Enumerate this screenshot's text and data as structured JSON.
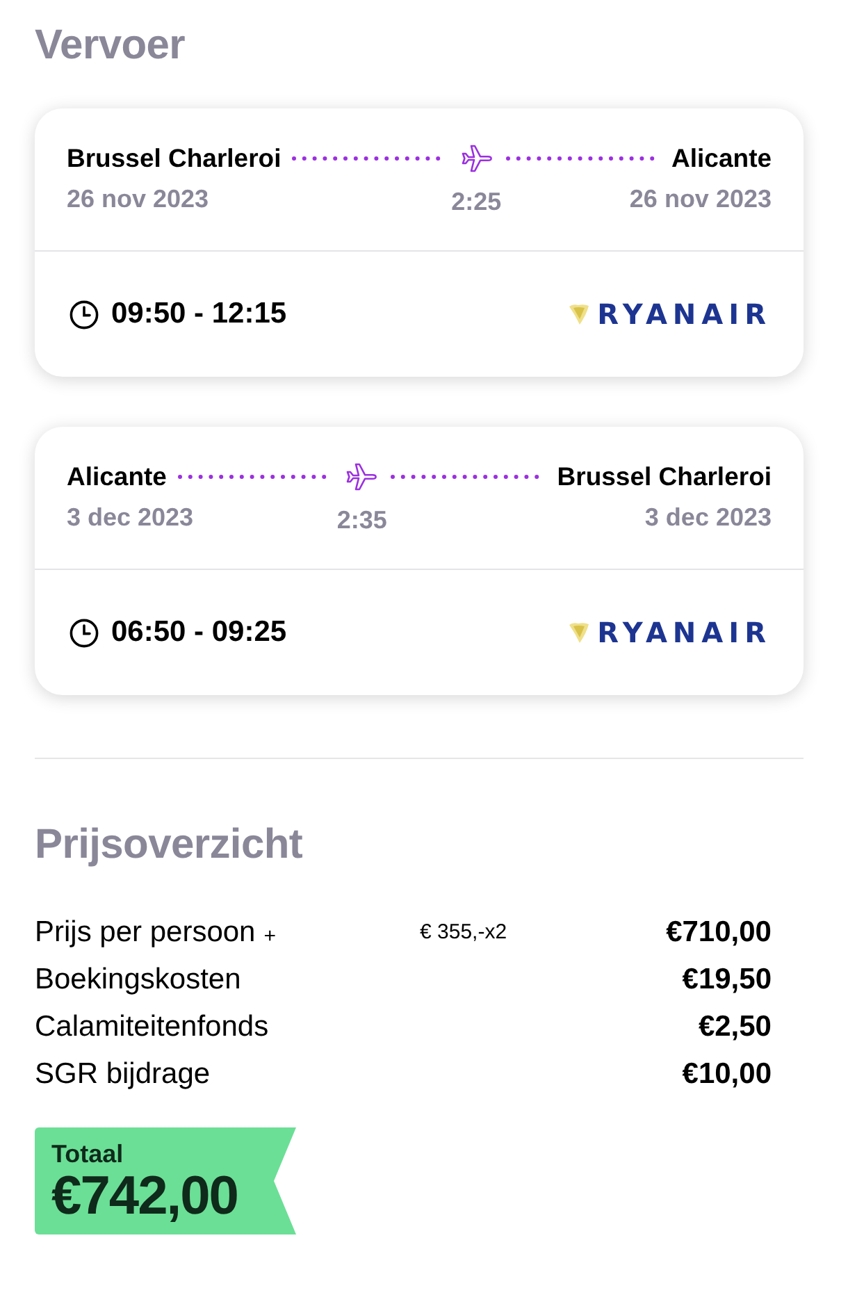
{
  "section_title": "Vervoer",
  "flights": [
    {
      "origin": "Brussel Charleroi",
      "destination": "Alicante",
      "departure_date": "26 nov 2023",
      "arrival_date": "26 nov 2023",
      "duration": "2:25",
      "time_range": "09:50 - 12:15",
      "airline": "RYANAIR"
    },
    {
      "origin": "Alicante",
      "destination": "Brussel Charleroi",
      "departure_date": "3 dec 2023",
      "arrival_date": "3 dec 2023",
      "duration": "2:35",
      "time_range": "06:50 - 09:25",
      "airline": "RYANAIR"
    }
  ],
  "price_overview": {
    "title": "Prijsoverzicht",
    "rows": [
      {
        "label": "Prijs per persoon",
        "toggle": "+",
        "detail": "€ 355,-x2",
        "amount": "€710,00"
      },
      {
        "label": "Boekingskosten",
        "amount": "€19,50"
      },
      {
        "label": "Calamiteitenfonds",
        "amount": "€2,50"
      },
      {
        "label": "SGR bijdrage",
        "amount": "€10,00"
      }
    ],
    "total": {
      "label": "Totaal",
      "amount": "€742,00"
    }
  }
}
